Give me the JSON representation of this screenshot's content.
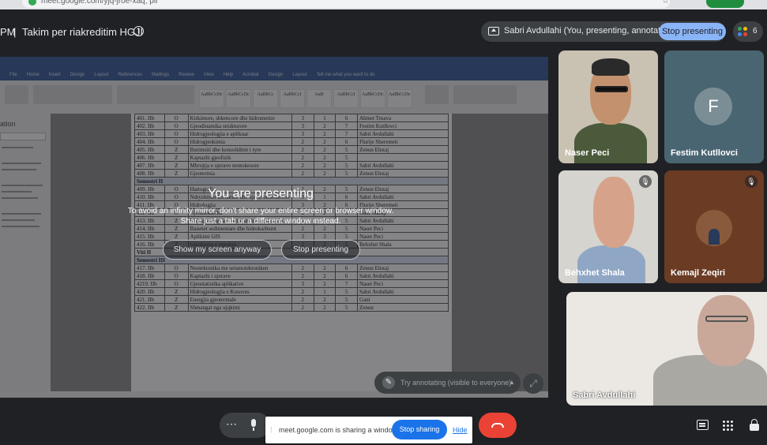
{
  "browser": {
    "url": "meet.google.com/yjq-jroe-xaq; pli"
  },
  "header": {
    "time": "PM",
    "separator": "|",
    "meeting_title": "Takim per riakreditim HGJI",
    "presenting_label": "Sabri Avdullahi (You, presenting, annotating)",
    "stop_presenting_label": "Stop presenting",
    "participant_count": "6",
    "colors": {
      "stop_pill": "#8ab4f8",
      "chip": "#3c4043"
    }
  },
  "overlay": {
    "title": "You are presenting",
    "line1": "To avoid an infinity mirror, don't share your entire screen or browser window.",
    "line2": "Share just a tab or a different window instead.",
    "show_anyway_label": "Show my screen anyway",
    "stop_presenting_label": "Stop presenting"
  },
  "shared_screen": {
    "word_tabs": [
      "File",
      "Home",
      "Insert",
      "Design",
      "Layout",
      "References",
      "Mailings",
      "Review",
      "View",
      "Help",
      "Acrobat",
      "Design",
      "Layout",
      "Tell me what you want to do"
    ],
    "styles": [
      "AaBbCcDc",
      "AaBbCcDc",
      "AaBbCc",
      "AaBbCcI",
      "AaB",
      "AaBbCcI",
      "AaBbCcDc",
      "AaBbCcDc"
    ],
    "nav_pane_title": "ation",
    "table_rows": [
      {
        "no": "401. IIb",
        "type": "O",
        "course": "Kirkimore, shkencore dhe hidrometire",
        "a": "3",
        "b": "1",
        "c": "6",
        "teacher": "Ahmet Tmava"
      },
      {
        "no": "402. IIb",
        "type": "O",
        "course": "Gjeodinamika strukturore",
        "a": "3",
        "b": "2",
        "c": "7",
        "teacher": "Festim Kutllovci"
      },
      {
        "no": "403. IIb",
        "type": "O",
        "course": "Hidrogjeologjia e aplikuar",
        "a": "3",
        "b": "2",
        "c": "7",
        "teacher": "Sabri Avdullahi"
      },
      {
        "no": "404. IIb",
        "type": "O",
        "course": "Hidrogjeokimia",
        "a": "2",
        "b": "2",
        "c": "6",
        "teacher": "Flurije Sheremeti"
      },
      {
        "no": "405. IIb",
        "type": "Z",
        "course": "Burimsiti dhe konsolidimi i tyre",
        "a": "2",
        "b": "2",
        "c": "5",
        "teacher": "Zenun Elezaj"
      },
      {
        "no": "406. IIb",
        "type": "Z",
        "course": "Kaptazhi gjeofizik",
        "a": "2",
        "b": "2",
        "c": "5",
        "teacher": ""
      },
      {
        "no": "407. IIb",
        "type": "Z",
        "course": "Mbrojtja e ujerave nentokesore",
        "a": "2",
        "b": "2",
        "c": "5",
        "teacher": "Sabri Avdullahi"
      },
      {
        "no": "408. IIb",
        "type": "Z",
        "course": "Gjeotermia",
        "a": "2",
        "b": "2",
        "c": "5",
        "teacher": "Zenun Elezaj"
      },
      {
        "sem": "Semestri II"
      },
      {
        "no": "409. IIb",
        "type": "O",
        "course": "Hartografia",
        "a": "2",
        "b": "2",
        "c": "5",
        "teacher": "Zenun Elezaj"
      },
      {
        "no": "410. IIb",
        "type": "O",
        "course": "Ndryshimet klimatike dhe ujerat nentokesore",
        "a": "3",
        "b": "1",
        "c": "6",
        "teacher": "Sabri Avdullahi"
      },
      {
        "no": "411. IIb",
        "type": "O",
        "course": "Hidrologjia",
        "a": "3",
        "b": "2",
        "c": "6",
        "teacher": "Flurije Sheremeti"
      },
      {
        "no": "412. IIb",
        "type": "O",
        "course": "Gjeomekanika",
        "a": "2",
        "b": "2",
        "c": "5",
        "teacher": "Gani Maliqi"
      },
      {
        "no": "413. IIb",
        "type": "Z",
        "course": "Hidrogjeologjia e vendburimeve minerale",
        "a": "2",
        "b": "2",
        "c": "5",
        "teacher": "Sabri Avdullahi"
      },
      {
        "no": "414. IIb",
        "type": "Z",
        "course": "Basenet sedimentare dhe hidrokarburet",
        "a": "2",
        "b": "2",
        "c": "5",
        "teacher": "Naser Peci"
      },
      {
        "no": "415. IIb",
        "type": "Z",
        "course": "Aplikimi GIS",
        "a": "3",
        "b": "3",
        "c": "5",
        "teacher": "Naser Peci"
      },
      {
        "no": "416. IIb",
        "type": "Z",
        "course": "Gjeokimia e mjedisit",
        "a": "2",
        "b": "2",
        "c": "5",
        "teacher": "Behxhet Shala"
      },
      {
        "viti": "Viti II"
      },
      {
        "sem": "Semestri III"
      },
      {
        "no": "417. IIb",
        "type": "O",
        "course": "Neotektonika me seismotektoniken",
        "a": "2",
        "b": "2",
        "c": "6",
        "teacher": "Zenun Elezaj"
      },
      {
        "no": "418. IIb",
        "type": "O",
        "course": "Kaptazhi i ujerave",
        "a": "2",
        "b": "2",
        "c": "6",
        "teacher": "Sabri Avdullahi"
      },
      {
        "no": "4219. IIb",
        "type": "O",
        "course": "Gjeostatistika aplikative",
        "a": "3",
        "b": "2",
        "c": "7",
        "teacher": "Naser Peci"
      },
      {
        "no": "420. IIb",
        "type": "Z",
        "course": "Hidrogjeologjia e Kosoves",
        "a": "2",
        "b": "1",
        "c": "5",
        "teacher": "Sabri Avdullahi"
      },
      {
        "no": "421. IIb",
        "type": "Z",
        "course": "Energjia gjeotermale",
        "a": "2",
        "b": "2",
        "c": "5",
        "teacher": "Gani"
      },
      {
        "no": "422. IIb",
        "type": "Z",
        "course": "Shmangat nga ujqkimi",
        "a": "2",
        "b": "2",
        "c": "5",
        "teacher": "Zenun"
      }
    ],
    "annotate_label": "Try annotating (visible to everyone)",
    "expand_icon": "expand-icon"
  },
  "participants": [
    {
      "name": "Naser Peci",
      "muted": false
    },
    {
      "name": "Festim Kutllovci",
      "initial": "F",
      "muted": false
    },
    {
      "name": "Behxhet Shala",
      "muted": true
    },
    {
      "name": "Kemajl Zeqiri",
      "muted": true
    },
    {
      "name": "Sabri Avdullahi",
      "muted": false
    }
  ],
  "controls": {
    "sharing_text": "meet.google.com is sharing a window.",
    "stop_sharing_label": "Stop sharing",
    "hide_label": "Hide",
    "colors": {
      "hangup": "#ea4335",
      "stop_sharing": "#1a73e8"
    }
  }
}
